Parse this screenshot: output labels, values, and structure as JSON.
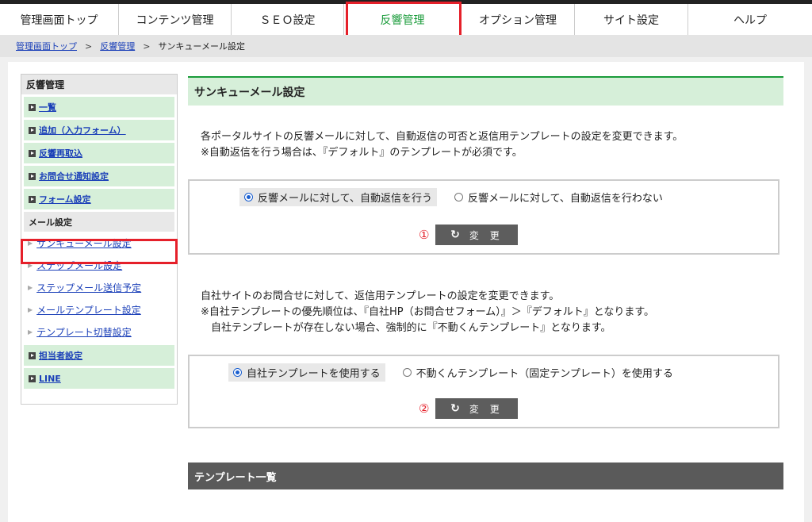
{
  "topnav": {
    "tabs": [
      {
        "label": "管理画面トップ"
      },
      {
        "label": "コンテンツ管理"
      },
      {
        "label": "ＳＥＯ設定"
      },
      {
        "label": "反響管理"
      },
      {
        "label": "オプション管理"
      },
      {
        "label": "サイト設定"
      },
      {
        "label": "ヘルプ"
      }
    ],
    "active_index": 3
  },
  "breadcrumb": {
    "items": [
      "管理画面トップ",
      "反響管理",
      "サンキューメール設定"
    ],
    "separator": ">"
  },
  "sidebar": {
    "title": "反響管理",
    "items_top": [
      "一覧",
      "追加（入力フォーム）",
      "反響再取込",
      "お問合せ通知設定",
      "フォーム設定"
    ],
    "mail_section": "メール設定",
    "mail_items": [
      "サンキューメール設定",
      "ステップメール設定",
      "ステップメール送信予定",
      "メールテンプレート設定",
      "テンプレート切替設定"
    ],
    "items_bottom": [
      "担当者設定",
      "LINE"
    ]
  },
  "main": {
    "title": "サンキューメール設定",
    "section1": {
      "desc1": "各ポータルサイトの反響メールに対して、自動返信の可否と返信用テンプレートの設定を変更できます。",
      "desc2": "※自動返信を行う場合は、『デフォルト』のテンプレートが必須です。",
      "option_on": "反響メールに対して、自動返信を行う",
      "option_off": "反響メールに対して、自動返信を行わない",
      "marker": "①",
      "button": "変 更"
    },
    "section2": {
      "desc1": "自社サイトのお問合せに対して、返信用テンプレートの設定を変更できます。",
      "desc2": "※自社テンプレートの優先順位は、『自社HP（お問合せフォーム）』＞『デフォルト』となります。",
      "desc3": "　自社テンプレートが存在しない場合、強制的に『不動くんテンプレート』となります。",
      "option_own": "自社テンプレートを使用する",
      "option_fixed": "不動くんテンプレート（固定テンプレート）を使用する",
      "marker": "②",
      "button": "変 更"
    },
    "template_list_title": "テンプレート一覧"
  },
  "colors": {
    "accent_green": "#1a9b3a",
    "highlight_red": "#e5202a",
    "link_blue": "#1a3fb8"
  }
}
